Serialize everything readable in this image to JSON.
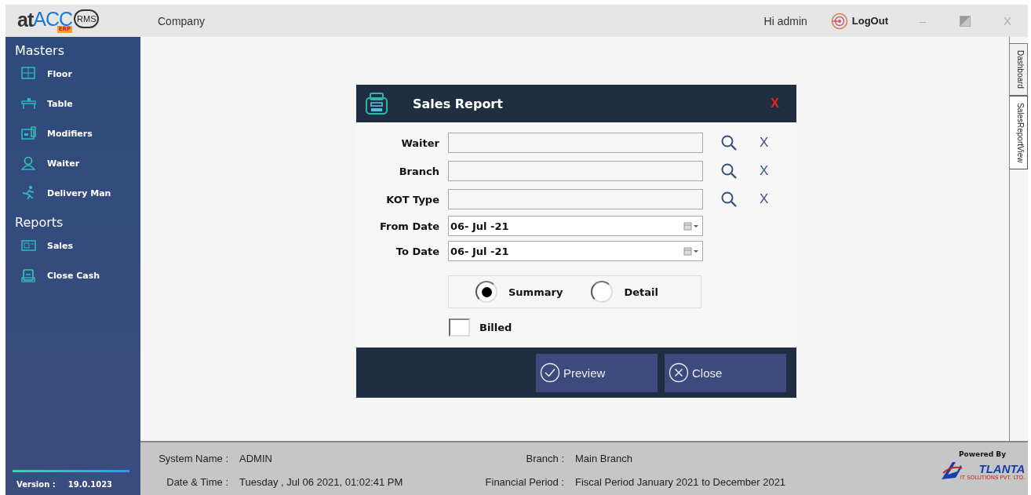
{
  "header": {
    "logo": {
      "at": "at",
      "acc": "ACC",
      "erp": "ERP",
      "rms": "RMS"
    },
    "company": "Company",
    "greeting": "Hi admin",
    "logout": "LogOut",
    "minimize": "–",
    "close": "X"
  },
  "sidebar": {
    "sections": [
      {
        "title": "Masters",
        "items": [
          {
            "label": "Floor",
            "kind": "floor"
          },
          {
            "label": "Table",
            "kind": "table"
          },
          {
            "label": "Modifiers",
            "kind": "modifiers"
          },
          {
            "label": "Waiter",
            "kind": "waiter"
          },
          {
            "label": "Delivery Man",
            "kind": "delivery"
          }
        ]
      },
      {
        "title": "Reports",
        "items": [
          {
            "label": "Sales",
            "kind": "sales"
          },
          {
            "label": "Close Cash",
            "kind": "cash"
          }
        ]
      }
    ],
    "version_label": "Version :",
    "version": "19.0.1023"
  },
  "side_tabs": [
    {
      "label": "Dashboard",
      "selected": false
    },
    {
      "label": "SalesReportView",
      "selected": true
    }
  ],
  "dialog": {
    "title": "Sales Report",
    "close": "X",
    "fields": [
      {
        "label": "Waiter",
        "kind": "lookup",
        "clear": "X"
      },
      {
        "label": "Branch",
        "kind": "lookup",
        "clear": "X"
      },
      {
        "label": "KOT Type",
        "kind": "lookup",
        "clear": "X"
      },
      {
        "label": "From Date",
        "kind": "date",
        "value": "06- Jul -21"
      },
      {
        "label": "To Date",
        "kind": "date",
        "value": "06- Jul -21"
      }
    ],
    "report_type": [
      {
        "label": "Summary",
        "selected": true
      },
      {
        "label": "Detail",
        "selected": false
      }
    ],
    "billed": {
      "label": "Billed",
      "checked": false
    },
    "buttons": [
      {
        "label": "Preview",
        "kind": "ok"
      },
      {
        "label": "Close",
        "kind": "cancel"
      }
    ]
  },
  "status_bar": {
    "items": [
      {
        "label": "System Name :",
        "value": "ADMIN"
      },
      {
        "label": "Branch :",
        "value": "Main Branch"
      },
      {
        "label": "Date & Time :",
        "value": "Tuesday , Jul 06 2021, 01:02:41 PM"
      },
      {
        "label": "Financial Period :",
        "value": "Fiscal Period January 2021 to December 2021"
      }
    ],
    "powered_by": "Powered By",
    "vendor": {
      "name": "TLANTA",
      "tagline": "IT SOLUTIONS PVT. LTD."
    }
  }
}
